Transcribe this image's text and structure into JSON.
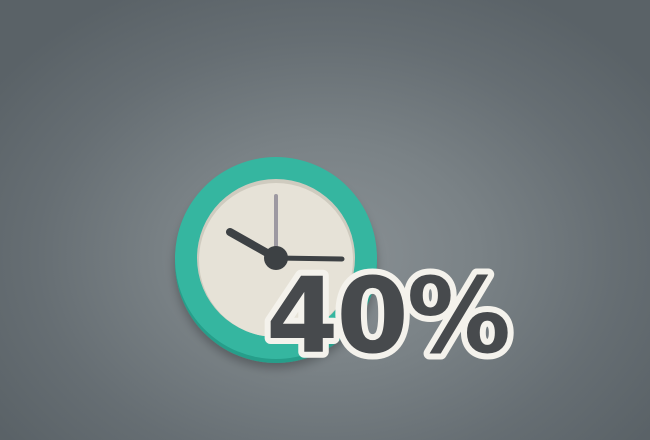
{
  "clock_badge": {
    "icon": "clock-icon",
    "percent_label": "40%",
    "colors": {
      "background": "#6a7276",
      "ring": "#35b6a0",
      "ring_shadow": "#289e8a",
      "face": "#e6e2d7",
      "hands": "#3d4144",
      "minute_hand": "#9d99a1",
      "text": "#474a4d",
      "text_outline": "#f4f2ec"
    }
  }
}
